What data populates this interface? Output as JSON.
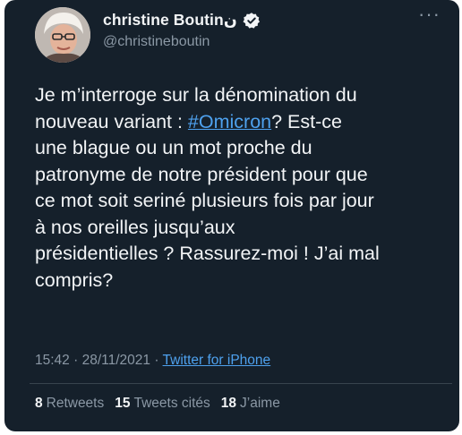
{
  "author": {
    "display_name": "christine Boutin",
    "name_emoji": "ن",
    "handle": "@christineboutin",
    "avatar_icon": "profile-photo-icon",
    "verified_icon": "verified-badge-icon"
  },
  "more_label": "···",
  "tweet": {
    "text_before": "Je m’interroge sur la dénomination du\nnouveau variant : ",
    "hashtag": "#Omicron",
    "text_after": "? Est-ce\nune blague ou un mot proche du\npatronyme de notre président pour que\nce mot soit seriné plusieurs fois par jour\nà nos oreilles jusqu’aux\nprésidentielles ? Rassurez-moi ! J’ai mal\ncompris?"
  },
  "meta": {
    "time": "15:42",
    "sep1": "·",
    "date": "28/11/2021",
    "sep2": "·",
    "source": "Twitter for iPhone"
  },
  "stats": {
    "retweets_count": "8",
    "retweets_label": "Retweets",
    "quotes_count": "15",
    "quotes_label": "Tweets cités",
    "likes_count": "18",
    "likes_label": "J’aime"
  },
  "colors": {
    "background": "#15202b",
    "text": "#f2f4f6",
    "secondary": "#8b98a5",
    "link": "#4ea1ee"
  }
}
